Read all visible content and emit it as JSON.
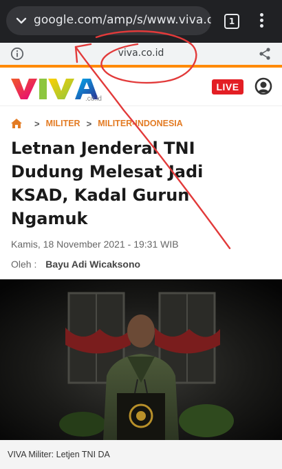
{
  "browser": {
    "url": "google.com/amp/s/www.viva.co",
    "tab_count": "1",
    "icons": [
      "chevron-down-icon",
      "tabs-icon",
      "more-vert-icon"
    ]
  },
  "amp_bar": {
    "domain": "viva.co.id",
    "icons": [
      "info-icon",
      "share-icon"
    ]
  },
  "site_header": {
    "logo_text": "VIVA",
    "logo_suffix": ".co.id",
    "live_label": "LIVE",
    "icons": [
      "user-icon"
    ]
  },
  "breadcrumb": {
    "items": [
      "MILITER",
      "MILITER-INDONESIA"
    ],
    "separator": ">",
    "icons": [
      "home-icon"
    ]
  },
  "article": {
    "title": "Letnan Jenderal TNI Dudung Melesat Jadi KSAD, Kadal Gurun Ngamuk",
    "date": "Kamis, 18 November 2021 - 19:31 WIB",
    "author_label": "Oleh :",
    "author_name": "Bayu Adi Wicaksono",
    "image_caption": "VIVA Militer: Letjen TNI DA"
  },
  "colors": {
    "browser_bg": "#202124",
    "accent_orange": "#ff8a00",
    "breadcrumb": "#e37b23",
    "live_red": "#e31e24",
    "annotation_red": "#e23a3a"
  }
}
